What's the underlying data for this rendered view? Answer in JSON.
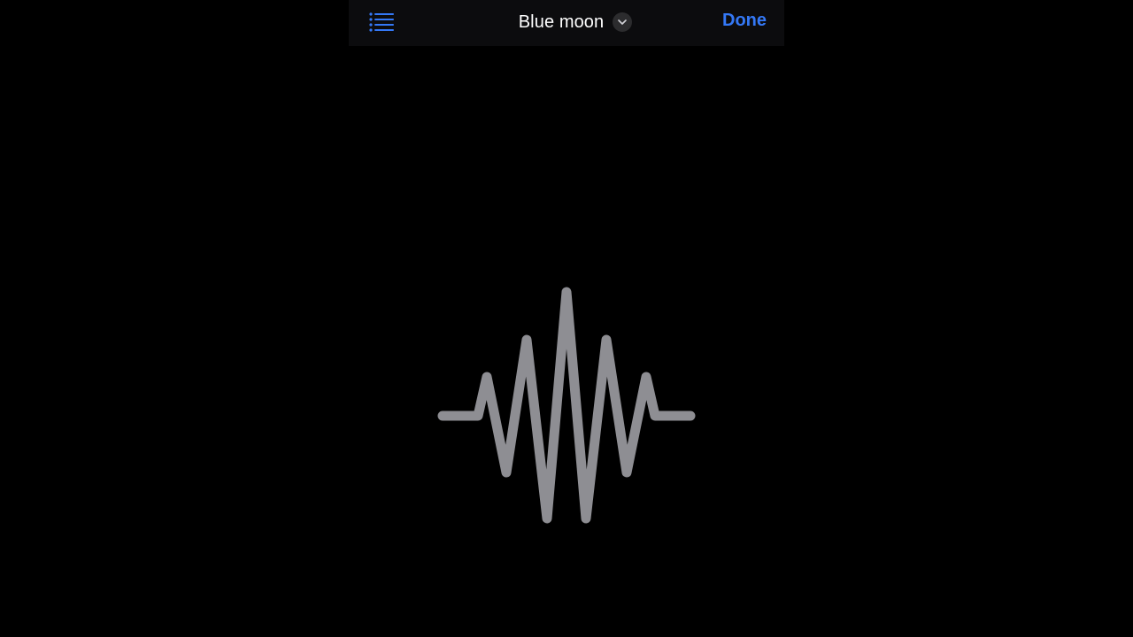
{
  "header": {
    "list_icon": "list-icon",
    "title": "Blue moon",
    "chevron_icon": "chevron-down-icon",
    "done_label": "Done"
  },
  "main": {
    "graphic_icon": "waveform-icon"
  },
  "colors": {
    "background": "#000000",
    "nav_background": "#0c0c0e",
    "accent": "#3478f6",
    "waveform": "#8e8e93",
    "title": "#ffffff"
  }
}
